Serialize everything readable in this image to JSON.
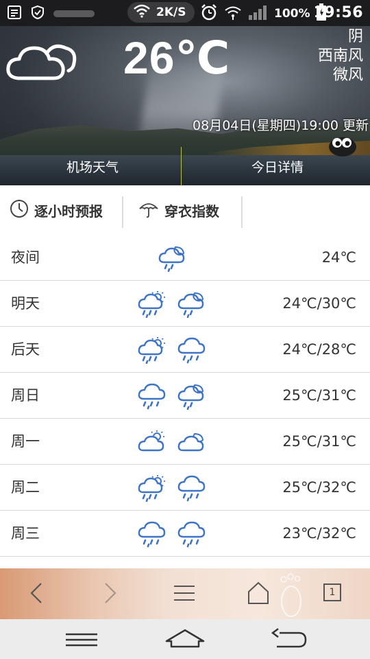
{
  "status_bar": {
    "speed": "2K/S",
    "battery": "100%",
    "time": "19:56",
    "icons": [
      "notes-icon",
      "shield-icon",
      "wifi-icon",
      "alarm-icon",
      "hotspot-icon",
      "signal-icon",
      "battery-icon"
    ]
  },
  "header": {
    "temperature": "26℃",
    "condition": "阴",
    "wind_direction": "西南风",
    "wind_level": "微风",
    "updated": "08月04日(星期四)19:00 更新",
    "tabs": [
      "机场天气",
      "今日详情"
    ]
  },
  "sections": {
    "hourly_label": "逐小时预报",
    "clothing_label": "穿衣指数"
  },
  "forecast": [
    {
      "day": "夜间",
      "range": "24℃",
      "icons": [
        "night-rain-icon"
      ]
    },
    {
      "day": "明天",
      "range": "24℃/30℃",
      "icons": [
        "sun-rain-icon",
        "night-rain-icon"
      ]
    },
    {
      "day": "后天",
      "range": "24℃/28℃",
      "icons": [
        "sun-rain-icon",
        "rain-icon"
      ]
    },
    {
      "day": "周日",
      "range": "25℃/31℃",
      "icons": [
        "rain-icon",
        "night-rain-icon"
      ]
    },
    {
      "day": "周一",
      "range": "25℃/31℃",
      "icons": [
        "partly-cloudy-icon",
        "night-cloudy-icon"
      ]
    },
    {
      "day": "周二",
      "range": "25℃/32℃",
      "icons": [
        "sun-rain-icon",
        "rain-icon"
      ]
    },
    {
      "day": "周三",
      "range": "23℃/32℃",
      "icons": [
        "rain-icon",
        "rain-icon"
      ]
    }
  ],
  "toolbar": {
    "tab_count": "1"
  },
  "colors": {
    "icon_blue": "#3e74c6",
    "text": "#333333",
    "divider": "#d9d9d9",
    "tab_divider": "#b7c04a"
  }
}
